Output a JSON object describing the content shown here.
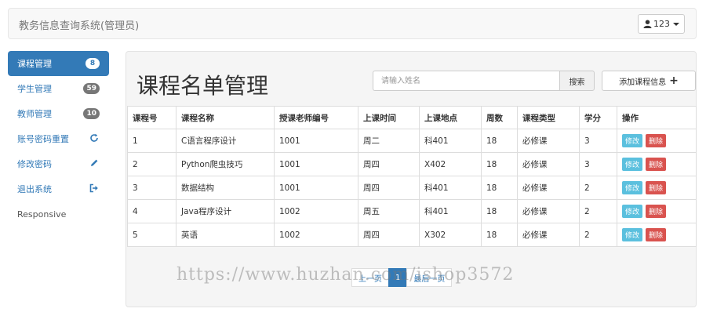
{
  "navbar": {
    "brand": "教务信息查询系统(管理员)",
    "user_label": "123"
  },
  "sidebar": {
    "items": [
      {
        "label": "课程管理",
        "badge": "8",
        "active": true
      },
      {
        "label": "学生管理",
        "badge": "59"
      },
      {
        "label": "教师管理",
        "badge": "10"
      },
      {
        "label": "账号密码重置",
        "icon": "refresh-icon"
      },
      {
        "label": "修改密码",
        "icon": "pencil-icon"
      },
      {
        "label": "退出系统",
        "icon": "logout-icon"
      },
      {
        "label": "Responsive"
      }
    ]
  },
  "main": {
    "title": "课程名单管理",
    "search": {
      "placeholder": "请输入姓名",
      "button": "搜索"
    },
    "add_button": "添加课程信息",
    "table": {
      "headers": [
        "课程号",
        "课程名称",
        "授课老师编号",
        "上课时间",
        "上课地点",
        "周数",
        "课程类型",
        "学分",
        "操作"
      ],
      "rows": [
        [
          "1",
          "C语言程序设计",
          "1001",
          "周二",
          "科401",
          "18",
          "必修课",
          "3"
        ],
        [
          "2",
          "Python爬虫技巧",
          "1001",
          "周四",
          "X402",
          "18",
          "必修课",
          "3"
        ],
        [
          "3",
          "数据结构",
          "1001",
          "周四",
          "科401",
          "18",
          "必修课",
          "2"
        ],
        [
          "4",
          "Java程序设计",
          "1002",
          "周五",
          "科401",
          "18",
          "必修课",
          "2"
        ],
        [
          "5",
          "英语",
          "1002",
          "周四",
          "X302",
          "18",
          "必修课",
          "2"
        ]
      ],
      "edit_label": "修改",
      "delete_label": "删除"
    },
    "pager": {
      "prev": "上一页",
      "current": "1",
      "next": "最后一页"
    }
  },
  "watermark": "https://www.huzhan.com/ishop3572",
  "colors": {
    "primary": "#337ab7",
    "info": "#5bc0de",
    "danger": "#d9534f"
  }
}
